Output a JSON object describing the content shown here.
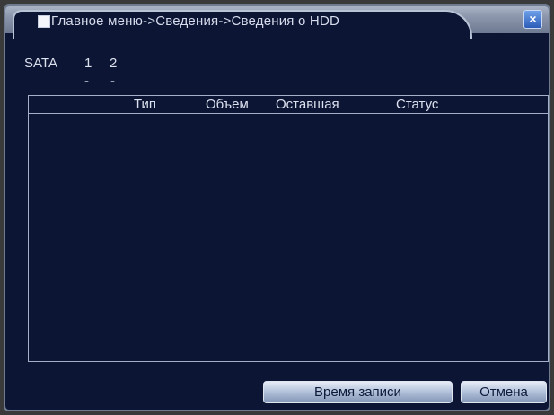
{
  "window": {
    "title": "Главное меню->Сведения->Сведения о HDD",
    "close_icon": "×"
  },
  "sata": {
    "label": "SATA",
    "ports": [
      {
        "num": "1",
        "status": "-"
      },
      {
        "num": "2",
        "status": "-"
      }
    ]
  },
  "table": {
    "columns": [
      "Тип",
      "Объем",
      "Оставшая",
      "Статус"
    ],
    "rows": []
  },
  "buttons": {
    "record_time": "Время записи",
    "cancel": "Отмена"
  },
  "colors": {
    "background": "#0c1534",
    "title_bar": "#8b95ab",
    "accent": "#2d5cb8"
  }
}
